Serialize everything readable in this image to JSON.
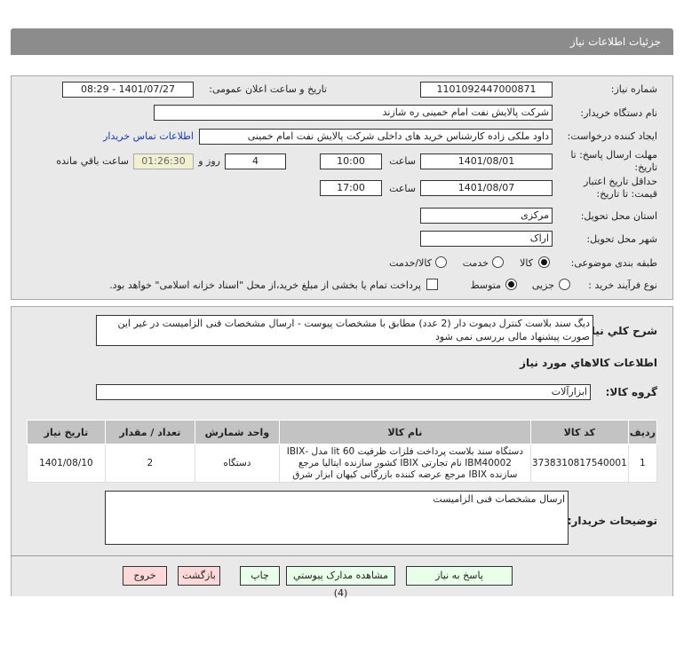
{
  "header": {
    "title": "جزئیات اطلاعات نیاز"
  },
  "form": {
    "need_number_label": "شماره نیاز:",
    "need_number": "1101092447000871",
    "announce_label": "تاریخ و ساعت اعلان عمومی:",
    "announce_value": "1401/07/27 - 08:29",
    "buyer_org_label": "نام دستگاه خریدار:",
    "buyer_org": "شرکت پالایش نفت امام خمینی  ره  شازند",
    "creator_label": "ایجاد کننده درخواست:",
    "creator": "داود  ملکی زاده کارشناس خرید های داخلی  شرکت پالایش نفت امام خمینی",
    "contact_link": "اطلاعات تماس خریدار",
    "deadline_label": "مهلت ارسال پاسخ: تا تاریخ:",
    "deadline_date": "1401/08/01",
    "time_label": "ساعت",
    "deadline_time": "10:00",
    "days": "4",
    "days_label": "روز و",
    "remaining": "01:26:30",
    "remaining_label": "ساعت باقي مانده",
    "validity_label": "حداقل تاریخ اعتبار قیمت: تا تاریخ:",
    "validity_date": "1401/08/07",
    "validity_time": "17:00",
    "province_label": "استان محل تحویل:",
    "province": "مرکزی",
    "city_label": "شهر محل تحویل:",
    "city": "اراک",
    "category_label": "طبقه بندی موضوعی:",
    "category_options": [
      "کالا",
      "خدمت",
      "کالا/خدمت"
    ],
    "category_selected": "کالا",
    "process_label": "نوع فرآیند خرید :",
    "process_options": [
      "جزیی",
      "متوسط"
    ],
    "process_selected": "متوسط",
    "payment_text": "پرداخت تمام یا بخشی از مبلغ خرید،از محل \"اسناد خزانه اسلامی\" خواهد بود."
  },
  "details": {
    "description_label": "شرح کلي نياز:",
    "description": "دیگ سند بلاست کنترل دیموت دار (2 عدد) مطابق با مشخصات پیوست - ارسال مشخصات فنی الزامیست در غیر این صورت پیشنهاد مالی بررسی نمی شود",
    "goods_title": "اطلاعات کالاهاي مورد نياز",
    "group_label": "گروه کالا:",
    "group": "ابزارآلات",
    "table": {
      "headers": [
        "ردیف",
        "کد کالا",
        "نام کالا",
        "واحد شمارش",
        "تعداد / مقدار",
        "تاریخ نیاز"
      ],
      "rows": [
        [
          "1",
          "3738310817540001",
          "دستگاه سند بلاست پرداخت فلزات ظرفیت 60 lit مدل -IBIX IBM40002 نام تجارتی IBIX کشور سازنده ایتالیا مرجع سازنده IBIX مرجع عرضه کننده بازرگانی کیهان ابزار شرق",
          "دستگاه",
          "2",
          "1401/08/10"
        ]
      ]
    },
    "notes_label": "توضیحات خریدار:",
    "notes": "ارسال مشخصات فنی الزامیست"
  },
  "buttons": {
    "reply": "پاسخ به نیاز",
    "attachments": "مشاهده مدارک پیوستي (4)",
    "print": "چاپ",
    "back": "بازگشت",
    "exit": "خروج"
  },
  "colors": {
    "header": "#8c8c8c",
    "panel": "#e9e9e9",
    "remaining_bg": "#f1f0d2",
    "green_btn": "#eaffea",
    "red_btn": "#ffd9d9",
    "link": "#1a3aa8"
  }
}
